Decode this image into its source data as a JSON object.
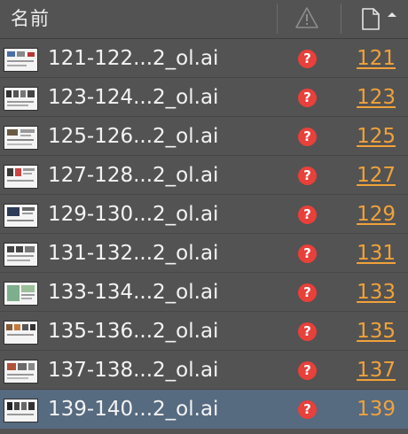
{
  "header": {
    "name_label": "名前",
    "warning_icon": "warning-triangle-icon",
    "page_icon": "page-icon",
    "sort_icon": "sort-ascending-icon"
  },
  "colors": {
    "background": "#535353",
    "selected_row": "#566a80",
    "page_link": "#f0a23a",
    "error_badge": "#e8403a",
    "text": "#f3f3f3"
  },
  "rows": [
    {
      "name": "121-122...2_ol.ai",
      "status_icon": "error-question-icon",
      "page": "121",
      "selected": false
    },
    {
      "name": "123-124...2_ol.ai",
      "status_icon": "error-question-icon",
      "page": "123",
      "selected": false
    },
    {
      "name": "125-126...2_ol.ai",
      "status_icon": "error-question-icon",
      "page": "125",
      "selected": false
    },
    {
      "name": "127-128...2_ol.ai",
      "status_icon": "error-question-icon",
      "page": "127",
      "selected": false
    },
    {
      "name": "129-130...2_ol.ai",
      "status_icon": "error-question-icon",
      "page": "129",
      "selected": false
    },
    {
      "name": "131-132...2_ol.ai",
      "status_icon": "error-question-icon",
      "page": "131",
      "selected": false
    },
    {
      "name": "133-134...2_ol.ai",
      "status_icon": "error-question-icon",
      "page": "133",
      "selected": false
    },
    {
      "name": "135-136...2_ol.ai",
      "status_icon": "error-question-icon",
      "page": "135",
      "selected": false
    },
    {
      "name": "137-138...2_ol.ai",
      "status_icon": "error-question-icon",
      "page": "137",
      "selected": false
    },
    {
      "name": "139-140...2_ol.ai",
      "status_icon": "error-question-icon",
      "page": "139",
      "selected": true
    }
  ],
  "error_glyph": "?"
}
